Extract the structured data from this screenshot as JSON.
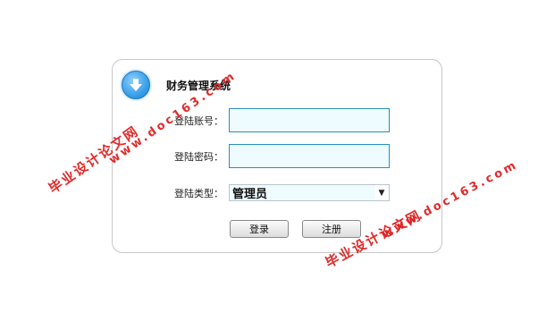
{
  "header": {
    "title": "财务管理系统",
    "logo_icon": "download-arrow-icon"
  },
  "form": {
    "account_label": "登陆账号：",
    "account_value": "",
    "password_label": "登陆密码：",
    "password_value": "",
    "type_label": "登陆类型：",
    "type_selected": "管理员",
    "type_arrow": "▼"
  },
  "buttons": {
    "login_label": "登录",
    "register_label": "注册"
  },
  "watermarks": {
    "left_cn": "毕业设计论文网",
    "left_url": "www.doc163.com",
    "right_cn": "毕业设计论文网",
    "right_url": "www.doc163.com"
  },
  "colors": {
    "input_border": "#2a8fbd",
    "input_bg": "#eefbff",
    "watermark": "#e02020"
  }
}
